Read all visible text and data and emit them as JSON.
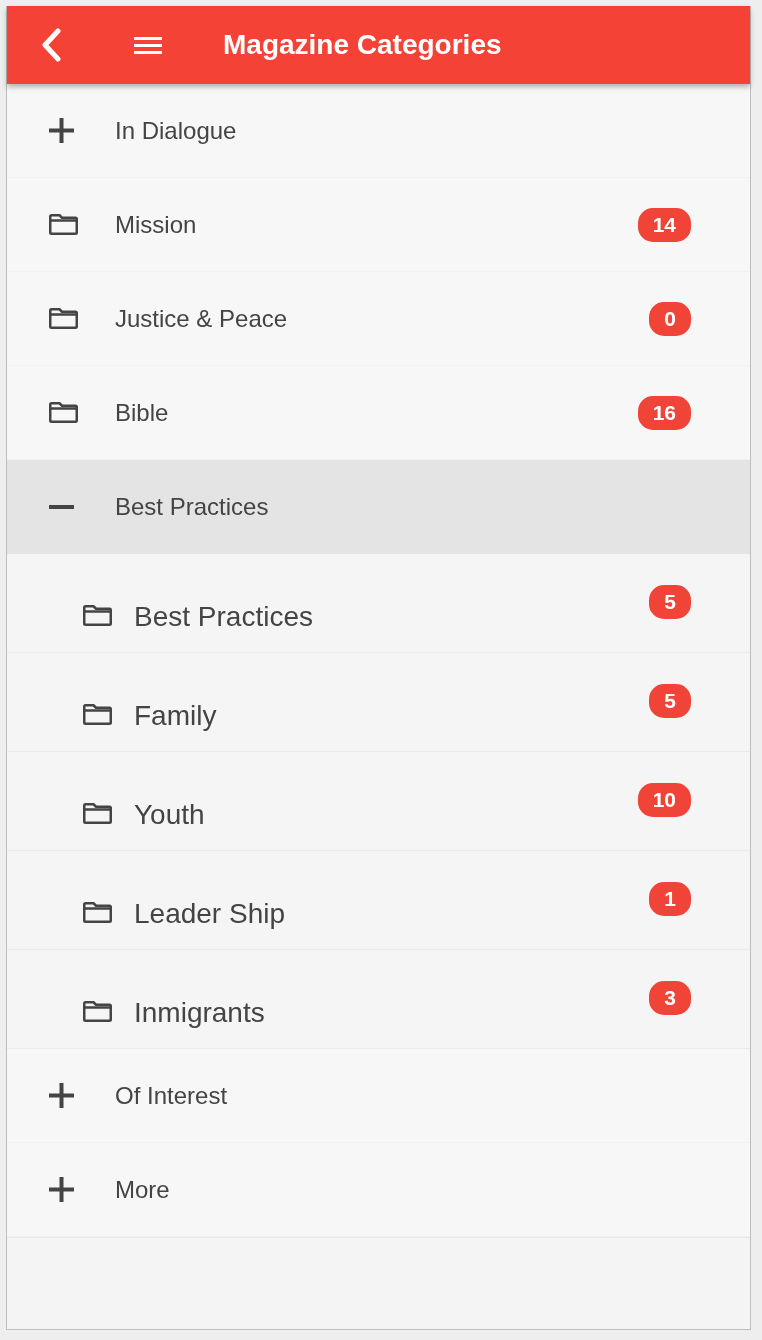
{
  "app_bar": {
    "title": "Magazine Categories"
  },
  "categories": [
    {
      "label": "In Dialogue",
      "kind": "group",
      "expanded": false
    },
    {
      "label": "Mission",
      "kind": "folder",
      "count": "14"
    },
    {
      "label": "Justice & Peace",
      "kind": "folder",
      "count": "0"
    },
    {
      "label": "Bible",
      "kind": "folder",
      "count": "16"
    },
    {
      "label": "Best Practices",
      "kind": "group",
      "expanded": true,
      "children": [
        {
          "label": "Best Practices",
          "count": "5"
        },
        {
          "label": "Family",
          "count": "5"
        },
        {
          "label": "Youth",
          "count": "10"
        },
        {
          "label": "Leader Ship",
          "count": "1"
        },
        {
          "label": "Inmigrants",
          "count": "3"
        }
      ]
    },
    {
      "label": "Of Interest",
      "kind": "group",
      "expanded": false
    },
    {
      "label": "More",
      "kind": "group",
      "expanded": false
    }
  ]
}
